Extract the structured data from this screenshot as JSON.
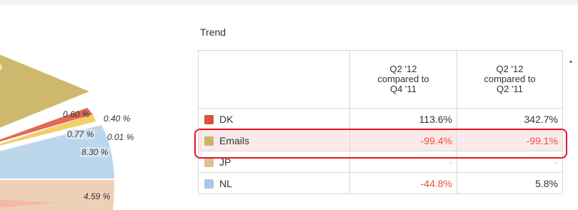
{
  "pie_labels": {
    "p060": "0.60 %",
    "p040": "0.40 %",
    "p077": "0.77 %",
    "p001": "0.01 %",
    "p830": "8.30 %",
    "p459": "4.59 %"
  },
  "trend": {
    "title": "Trend",
    "columns": [
      {
        "line1": "Q2 '12",
        "line2": "compared to",
        "line3": "Q4 '11"
      },
      {
        "line1": "Q2 '12",
        "line2": "compared to",
        "line3": "Q2 '11"
      }
    ],
    "rows": [
      {
        "name": "DK",
        "color": "#d9533a",
        "c1": "113.6%",
        "c2": "342.7%"
      },
      {
        "name": "Emails",
        "color": "#c9b56a",
        "c1": "-99.4%",
        "c2": "-99.1%"
      },
      {
        "name": "JP",
        "color": "#e2be96",
        "c1": "-",
        "c2": "-"
      },
      {
        "name": "NL",
        "color": "#a9c8e4",
        "c1": "-44.8%",
        "c2": "5.8%"
      }
    ]
  },
  "colors": {
    "negative": "#e8513a",
    "highlight_outline": "#e8141e",
    "highlight_fill": "#fce9ea"
  },
  "icons": {
    "scroll": "scroll-up-arrow-icon"
  }
}
